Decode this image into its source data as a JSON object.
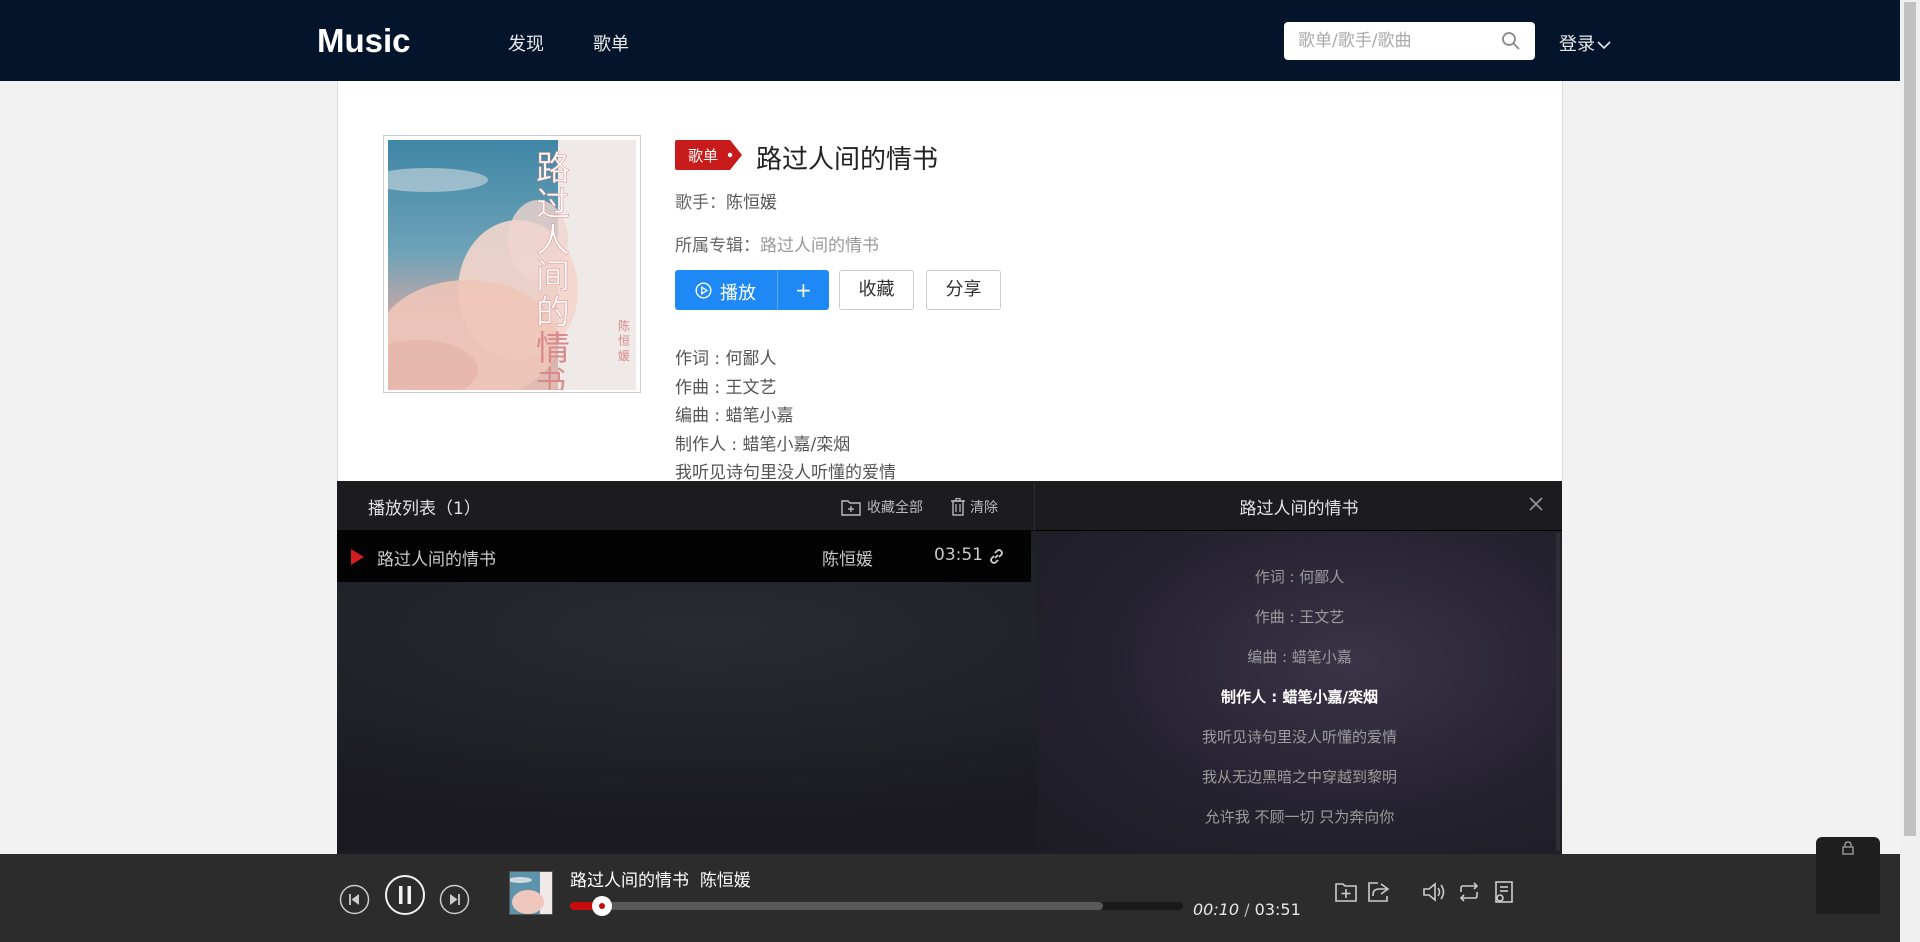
{
  "header": {
    "logo": "Music",
    "nav": [
      {
        "label": "发现"
      },
      {
        "label": "歌单"
      }
    ],
    "search_placeholder": "歌单/歌手/歌曲",
    "login_label": "登录"
  },
  "song": {
    "tag": "歌单",
    "title": "路过人间的情书",
    "singer_label": "歌手：",
    "singer": "陈恒媛",
    "album_label": "所属专辑：",
    "album": "路过人间的情书",
    "play_label": "播放",
    "add_label": "+",
    "collect_label": "收藏",
    "share_label": "分享",
    "lyrics_preview": [
      "作词 : 何鄙人",
      "作曲 : 王文艺",
      "编曲 : 蜡笔小嘉",
      "制作人 : 蜡笔小嘉/栾烟",
      "我听见诗句里没人听懂的爱情"
    ],
    "cover_text": "路过人间的情书",
    "cover_artist": "陈恒媛"
  },
  "playlist": {
    "title": "播放列表（1）",
    "collect_all": "收藏全部",
    "clear": "清除",
    "rows": [
      {
        "name": "路过人间的情书",
        "artist": "陈恒媛",
        "duration": "03:51"
      }
    ]
  },
  "lyrics_panel": {
    "title": "路过人间的情书",
    "lines": [
      "作词 : 何鄙人",
      "作曲 : 王文艺",
      "编曲 : 蜡笔小嘉",
      "制作人 : 蜡笔小嘉/栾烟",
      "我听见诗句里没人听懂的爱情",
      "我从无边黑暗之中穿越到黎明",
      "允许我 不顾一切 只为奔向你"
    ],
    "current_index": 3
  },
  "player": {
    "song": "路过人间的情书",
    "artist": "陈恒媛",
    "current": "00:10",
    "separator": " / ",
    "total": "03:51",
    "progress": 0.043,
    "buffered": 0.87
  },
  "colors": {
    "topbar": "#04142a",
    "accent_blue": "#1e89f5",
    "accent_red": "#c70c0c",
    "panel_bg": "#1d1c22",
    "player_bg": "#2c2c2c"
  }
}
